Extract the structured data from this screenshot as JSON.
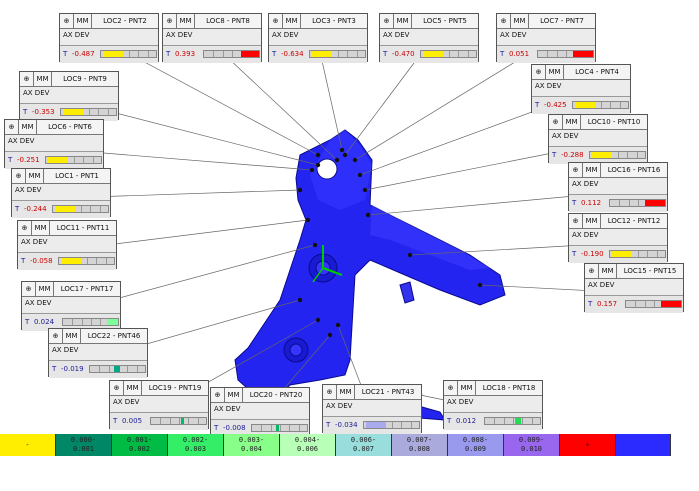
{
  "header_icon": "crosshair-icon",
  "unit": "MM",
  "dev_label": "AX DEV",
  "row_prefix": "T",
  "colors": {
    "part": "#2222ee",
    "red": "#ff0000",
    "yellow": "#ffee00",
    "green": "#00bb33",
    "blue": "#2b2bff"
  },
  "labels": [
    {
      "name": "LOC2 - PNT2",
      "value": "-0.487",
      "color": "#ffee00",
      "fill": 0.35,
      "red": true
    },
    {
      "name": "LOC8 - PNT8",
      "value": "0.393",
      "color": "#ff0000",
      "fill": 0.32,
      "side": "right",
      "red": true
    },
    {
      "name": "LOC3 - PNT3",
      "value": "-0.634",
      "color": "#ffee00",
      "fill": 0.35,
      "red": true
    },
    {
      "name": "LOC5 - PNT5",
      "value": "-0.470",
      "color": "#ffee00",
      "fill": 0.35,
      "red": true
    },
    {
      "name": "LOC7 - PNT7",
      "value": "0.051",
      "color": "#ff0000",
      "fill": 0.35,
      "side": "right",
      "red": true
    },
    {
      "name": "LOC9 - PNT9",
      "value": "-0.353",
      "color": "#ffee00",
      "fill": 0.35,
      "red": true
    },
    {
      "name": "LOC4 - PNT4",
      "value": "-0.425",
      "color": "#ffee00",
      "fill": 0.35,
      "red": true
    },
    {
      "name": "LOC6 - PNT6",
      "value": "-0.251",
      "color": "#ffee00",
      "fill": 0.35,
      "red": true
    },
    {
      "name": "LOC10 - PNT10",
      "value": "-0.288",
      "color": "#ffee00",
      "fill": 0.35,
      "red": true
    },
    {
      "name": "LOC1 - PNT1",
      "value": "-0.244",
      "color": "#ffee00",
      "fill": 0.35,
      "red": true
    },
    {
      "name": "LOC16 - PNT16",
      "value": "0.112",
      "color": "#ff0000",
      "fill": 0.35,
      "side": "right",
      "red": true
    },
    {
      "name": "LOC11 - PNT11",
      "value": "-0.058",
      "color": "#ffee00",
      "fill": 0.35,
      "red": true
    },
    {
      "name": "LOC12 - PNT12",
      "value": "-0.190",
      "color": "#ffee00",
      "fill": 0.35,
      "red": true
    },
    {
      "name": "LOC15 - PNT15",
      "value": "0.157",
      "color": "#ff0000",
      "fill": 0.35,
      "side": "right",
      "red": true
    },
    {
      "name": "LOC17 - PNT17",
      "value": "0.024",
      "color": "#7fff9a",
      "fill": 0.2,
      "side": "right",
      "red": false
    },
    {
      "name": "LOC22 - PNT46",
      "value": "-0.019",
      "color": "#00aa88",
      "fill": 0.1,
      "side": "left-center",
      "red": false
    },
    {
      "name": "LOC19 - PNT19",
      "value": "0.005",
      "color": "#00bb66",
      "fill": 0.05,
      "side": "right-center",
      "red": false
    },
    {
      "name": "LOC20 - PNT20",
      "value": "-0.008",
      "color": "#00bb66",
      "fill": 0.05,
      "side": "left-center",
      "red": false
    },
    {
      "name": "LOC21 - PNT43",
      "value": "-0.034",
      "color": "#aaaaee",
      "fill": 0.35,
      "side": "left",
      "red": false
    },
    {
      "name": "LOC18 - PNT18",
      "value": "0.012",
      "color": "#22dd55",
      "fill": 0.1,
      "side": "right-center",
      "red": false
    }
  ],
  "legend": [
    {
      "text": "-",
      "color": "#ffee00"
    },
    {
      "text": "0.000-\n0.001",
      "color": "#008866"
    },
    {
      "text": "0.001-\n0.002",
      "color": "#00bb44"
    },
    {
      "text": "0.002-\n0.003",
      "color": "#33ee66"
    },
    {
      "text": "0.003-\n0.004",
      "color": "#88ff88"
    },
    {
      "text": "0.004-\n0.006",
      "color": "#b8ffb8"
    },
    {
      "text": "0.006-\n0.007",
      "color": "#99dddd"
    },
    {
      "text": "0.007-\n0.008",
      "color": "#aaaadd"
    },
    {
      "text": "0.008-\n0.009",
      "color": "#9999ee"
    },
    {
      "text": "0.009-\n0.010",
      "color": "#9966ee"
    },
    {
      "text": "+",
      "color": "#ff0000"
    },
    {
      "text": "",
      "color": "#2b2bff"
    }
  ]
}
